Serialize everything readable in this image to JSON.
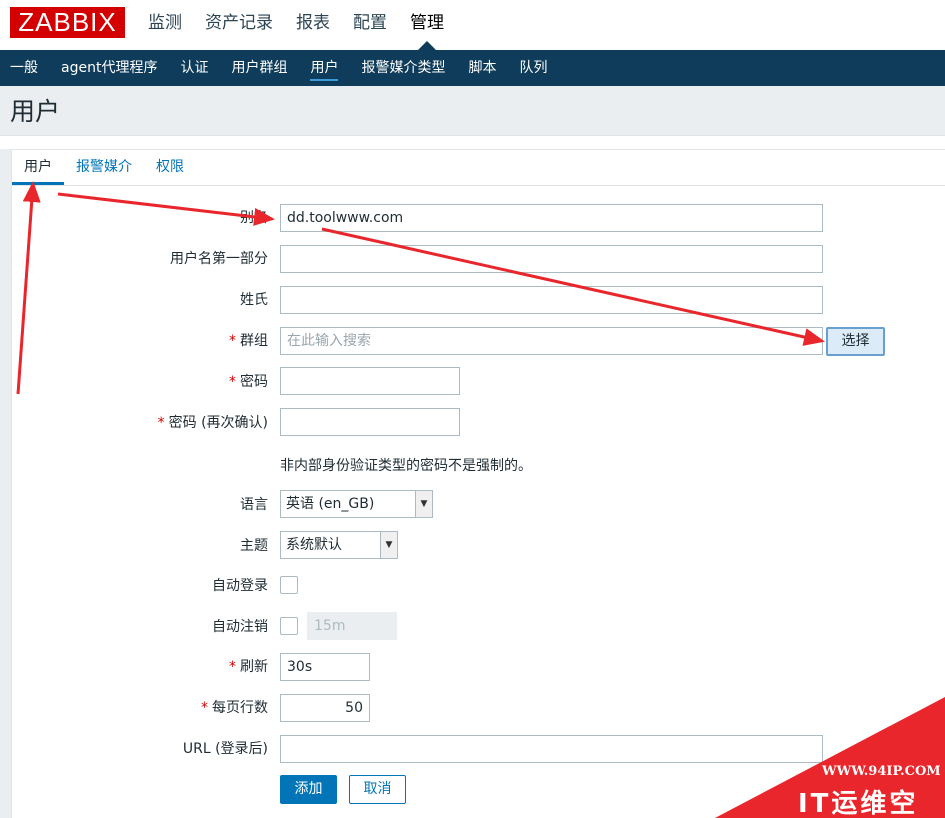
{
  "logo": "ZABBIX",
  "top_menu": [
    "监测",
    "资产记录",
    "报表",
    "配置",
    "管理"
  ],
  "sub_nav": [
    "一般",
    "agent代理程序",
    "认证",
    "用户群组",
    "用户",
    "报警媒介类型",
    "脚本",
    "队列"
  ],
  "page_title": "用户",
  "tabs": [
    "用户",
    "报警媒介",
    "权限"
  ],
  "form": {
    "alias": {
      "label": "别名",
      "value": "dd.toolwww.com"
    },
    "first_name": {
      "label": "用户名第一部分",
      "value": ""
    },
    "surname": {
      "label": "姓氏",
      "value": ""
    },
    "groups": {
      "label": "群组",
      "placeholder": "在此输入搜索",
      "button": "选择"
    },
    "password": {
      "label": "密码",
      "value": ""
    },
    "password_confirm": {
      "label": "密码 (再次确认)",
      "value": ""
    },
    "password_hint": "非内部身份验证类型的密码不是强制的。",
    "language": {
      "label": "语言",
      "value": "英语 (en_GB)"
    },
    "theme": {
      "label": "主题",
      "value": "系统默认"
    },
    "autologin": {
      "label": "自动登录"
    },
    "autologout": {
      "label": "自动注销",
      "value": "15m"
    },
    "refresh": {
      "label": "刷新",
      "value": "30s"
    },
    "rows_per_page": {
      "label": "每页行数",
      "value": "50"
    },
    "url": {
      "label": "URL (登录后)",
      "value": ""
    },
    "add_button": "添加",
    "cancel_button": "取消"
  },
  "watermark": {
    "site": "WWW.94IP.COM",
    "name": "IT运维空间"
  },
  "colors": {
    "logo_bg": "#d40000",
    "nav_bg": "#0e3c5a",
    "link": "#0275b8",
    "required": "#d40000",
    "annotation_arrow": "#e8262b"
  }
}
